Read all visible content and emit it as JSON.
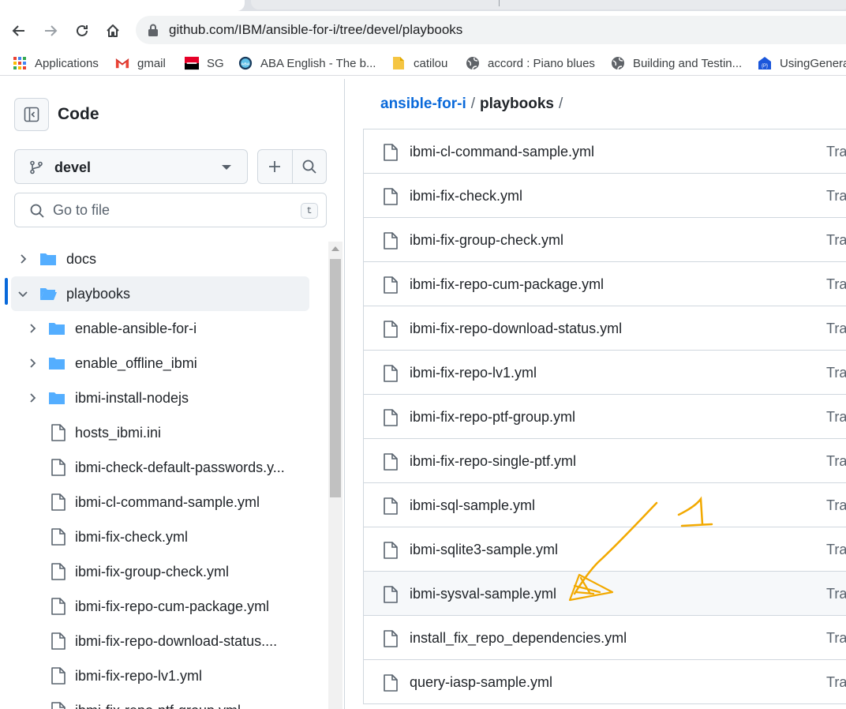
{
  "browser": {
    "url": "github.com/IBM/ansible-for-i/tree/devel/playbooks",
    "bookmarks": [
      {
        "label": "Applications",
        "icon": "apps-grid-icon"
      },
      {
        "label": "gmail",
        "icon": "gmail-icon"
      },
      {
        "label": "SG",
        "icon": "sg-icon"
      },
      {
        "label": "ABA English - The b...",
        "icon": "aba-icon"
      },
      {
        "label": "catilou",
        "icon": "folder-bookmark-icon"
      },
      {
        "label": "accord : Piano blues",
        "icon": "globe-icon"
      },
      {
        "label": "Building and Testin...",
        "icon": "globe-icon"
      },
      {
        "label": "UsingGenera",
        "icon": "site-icon"
      }
    ]
  },
  "panel": {
    "title": "Code",
    "branch": "devel",
    "search_placeholder": "Go to file",
    "search_shortcut": "t"
  },
  "tree": [
    {
      "label": "docs",
      "type": "folder",
      "expanded": false
    },
    {
      "label": "playbooks",
      "type": "folder",
      "expanded": true,
      "selected": true
    },
    {
      "label": "enable-ansible-for-i",
      "type": "folder",
      "expanded": false
    },
    {
      "label": "enable_offline_ibmi",
      "type": "folder",
      "expanded": false
    },
    {
      "label": "ibmi-install-nodejs",
      "type": "folder",
      "expanded": false
    },
    {
      "label": "hosts_ibmi.ini",
      "type": "file"
    },
    {
      "label": "ibmi-check-default-passwords.y...",
      "type": "file"
    },
    {
      "label": "ibmi-cl-command-sample.yml",
      "type": "file"
    },
    {
      "label": "ibmi-fix-check.yml",
      "type": "file"
    },
    {
      "label": "ibmi-fix-group-check.yml",
      "type": "file"
    },
    {
      "label": "ibmi-fix-repo-cum-package.yml",
      "type": "file"
    },
    {
      "label": "ibmi-fix-repo-download-status....",
      "type": "file"
    },
    {
      "label": "ibmi-fix-repo-lv1.yml",
      "type": "file"
    },
    {
      "label": "ibmi-fix-repo-ptf-group.yml",
      "type": "file"
    }
  ],
  "breadcrumb": {
    "repo": "ansible-for-i",
    "separator": "/",
    "current": "playbooks",
    "trailing": "/"
  },
  "files": [
    {
      "name": "ibmi-cl-command-sample.yml",
      "message": "Tra"
    },
    {
      "name": "ibmi-fix-check.yml",
      "message": "Tra"
    },
    {
      "name": "ibmi-fix-group-check.yml",
      "message": "Tra"
    },
    {
      "name": "ibmi-fix-repo-cum-package.yml",
      "message": "Tra"
    },
    {
      "name": "ibmi-fix-repo-download-status.yml",
      "message": "Tra"
    },
    {
      "name": "ibmi-fix-repo-lv1.yml",
      "message": "Tra"
    },
    {
      "name": "ibmi-fix-repo-ptf-group.yml",
      "message": "Tra"
    },
    {
      "name": "ibmi-fix-repo-single-ptf.yml",
      "message": "Tra"
    },
    {
      "name": "ibmi-sql-sample.yml",
      "message": "Tra"
    },
    {
      "name": "ibmi-sqlite3-sample.yml",
      "message": "Tra"
    },
    {
      "name": "ibmi-sysval-sample.yml",
      "message": "Tra",
      "hover": true
    },
    {
      "name": "install_fix_repo_dependencies.yml",
      "message": "Tra"
    },
    {
      "name": "query-iasp-sample.yml",
      "message": "Tra"
    }
  ],
  "annotation": {
    "label": "1",
    "color": "#f2a900"
  }
}
